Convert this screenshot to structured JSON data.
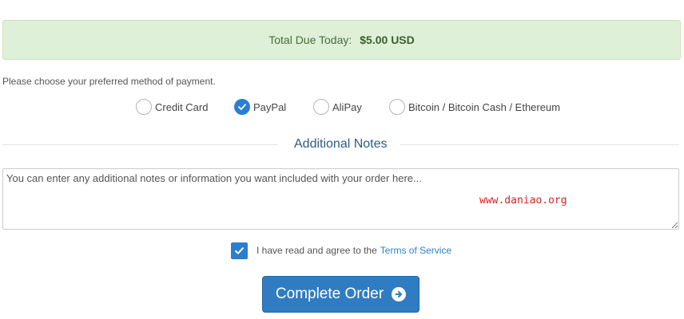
{
  "summary": {
    "total_label": "Total Due Today:",
    "total_amount": "$5.00 USD"
  },
  "payment": {
    "instructions": "Please choose your preferred method of payment.",
    "methods": [
      {
        "label": "Credit Card",
        "selected": false
      },
      {
        "label": "PayPal",
        "selected": true
      },
      {
        "label": "AliPay",
        "selected": false
      },
      {
        "label": "Bitcoin / Bitcoin Cash / Ethereum",
        "selected": false
      }
    ]
  },
  "notes": {
    "heading": "Additional Notes",
    "placeholder": "You can enter any additional notes or information you want included with your order here...",
    "watermark": "www.daniao.org"
  },
  "terms": {
    "agree_text": "I have read and agree to the",
    "link_text": "Terms of Service",
    "checked": true
  },
  "actions": {
    "complete_label": "Complete Order"
  },
  "colors": {
    "accent": "#2f7cc2",
    "success_bg": "#dff0d8",
    "heading": "#2e5a86"
  },
  "icons": {
    "radio_check": "check-icon",
    "checkbox_check": "check-icon",
    "complete_arrow": "arrow-circle-right-icon"
  }
}
